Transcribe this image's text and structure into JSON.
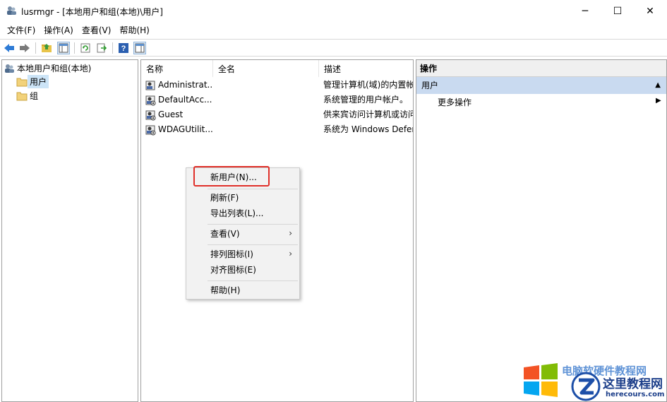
{
  "window": {
    "title": "lusrmgr - [本地用户和组(本地)\\用户]",
    "minimize": "─",
    "maximize": "☐",
    "close": "✕"
  },
  "menu": [
    "文件(F)",
    "操作(A)",
    "查看(V)",
    "帮助(H)"
  ],
  "tree": {
    "root": "本地用户和组(本地)",
    "children": [
      "用户",
      "组"
    ],
    "selected": "用户"
  },
  "list": {
    "columns": [
      "名称",
      "全名",
      "描述"
    ],
    "rows": [
      {
        "name": "Administrat...",
        "fullname": "",
        "description": "管理计算机(域)的内置帐"
      },
      {
        "name": "DefaultAcc...",
        "fullname": "",
        "description": "系统管理的用户帐户。"
      },
      {
        "name": "Guest",
        "fullname": "",
        "description": "供来宾访问计算机或访问"
      },
      {
        "name": "WDAGUtilit...",
        "fullname": "",
        "description": "系统为 Windows Defer"
      }
    ]
  },
  "actions": {
    "header": "操作",
    "section": "用户",
    "more": "更多操作"
  },
  "context_menu": {
    "items": [
      "新用户(N)...",
      "刷新(F)",
      "导出列表(L)...",
      "查看(V)",
      "排列图标(I)",
      "对齐图标(E)",
      "帮助(H)"
    ]
  },
  "watermark": {
    "line1": "电脑软硬件教程网",
    "line2": "这里教程网",
    "line3": "herecours.com"
  },
  "colors": {
    "highlight": "#e0302a",
    "selection": "#cce4f7",
    "action_section": "#c9daf0"
  }
}
